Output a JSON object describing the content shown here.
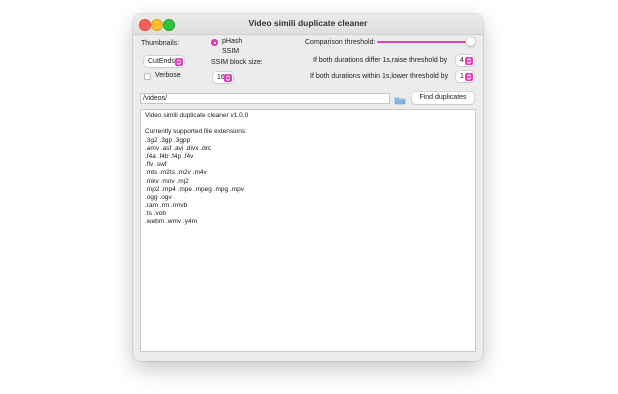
{
  "window": {
    "title": "Video simili duplicate cleaner"
  },
  "thumbnails": {
    "label": "Thumbnails:",
    "mode_value": "CutEnds"
  },
  "method": {
    "options": [
      {
        "label": "pHash",
        "selected": true
      },
      {
        "label": "SSIM",
        "selected": false
      }
    ],
    "ssim_block_label": "SSIM block size:",
    "ssim_block_value": "16"
  },
  "verbose": {
    "label": "Verbose",
    "checked": false
  },
  "comparison": {
    "label": "Comparison threshold:"
  },
  "durations": {
    "differ_label": "If both durations differ 1s,raise threshold by",
    "differ_value": "4",
    "within_label": "If both durations within 1s,lower threshold by",
    "within_value": "1"
  },
  "path": {
    "value": "/videos/"
  },
  "find_button": {
    "label": "Find duplicates"
  },
  "output": {
    "lines": [
      "Video simili duplicate cleaner v1.0.0",
      "",
      "Currently supported file extensions:",
      ".3g2 .3gp .3gpp",
      ".amv .asf .avi .divx .drc",
      ".f4a .f4b .f4p .f4v",
      ".flv .swf",
      ".mts .m2ts .m2v .m4v",
      ".mkv .mov .mj2",
      ".mp2 .mp4 .mpe .mpeg .mpg .mpv",
      ".ogg .ogv",
      ".ram .rm .rmvb",
      ".ts .vob",
      ".webm .wmv .y4m"
    ]
  },
  "colors": {
    "accent": "#e040b8",
    "window_bg": "#ececec"
  },
  "icons": {
    "folder": "folder-icon",
    "popup_arrows": "updown-arrows-icon"
  }
}
